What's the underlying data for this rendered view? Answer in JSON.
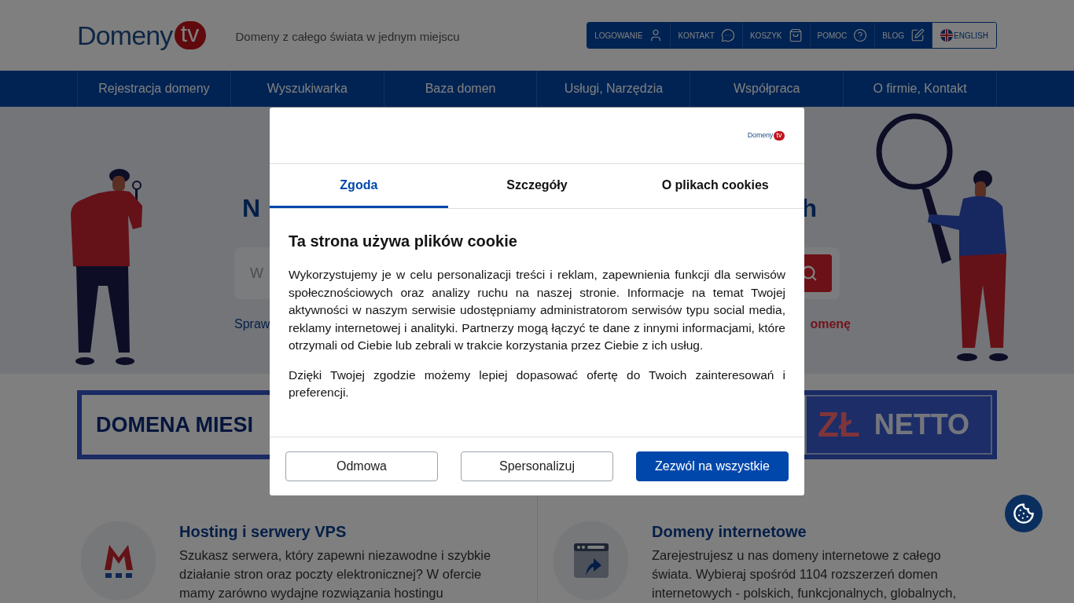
{
  "header": {
    "logo": {
      "name": "Domeny",
      "tld": "tv"
    },
    "tagline": "Domeny z całego świata w jednym miejscu",
    "top_links": [
      {
        "label": "LOGOWANIE",
        "kind": "user"
      },
      {
        "label": "KONTAKT",
        "kind": "chat"
      },
      {
        "label": "KOSZYK",
        "kind": "bag"
      },
      {
        "label": "POMOC",
        "kind": "help"
      },
      {
        "label": "BLOG",
        "kind": "edit"
      }
    ],
    "language": "ENGLISH"
  },
  "nav": [
    "Rejestracja domeny",
    "Wyszukiwarka",
    "Baza domen",
    "Usługi, Narzędzia",
    "Współpraca",
    "O firmie, Kontakt"
  ],
  "hero": {
    "heading_left": "N",
    "heading_right": "h",
    "search_placeholder": "W",
    "link_left": "Spraw",
    "link_right": "omenę"
  },
  "banner": {
    "left_text": "DOMENA MIESI",
    "currency": "ZŁ",
    "suffix": "NETTO"
  },
  "features": [
    {
      "kind": "hosting",
      "title": "Hosting i serwery VPS",
      "text": "Szukasz serwera, który zapewni niezawodne i szybkie działanie stron oraz poczty elektronicznej? W ofercie mamy zarówno wydajne rozwiązania hostingu"
    },
    {
      "kind": "domains",
      "title": "Domeny internetowe",
      "text": "Zarejestrujesz u nas domeny internetowe z całego świata. Wybieraj spośród 1104 rozszerzeń domen internetowych - polskich, funkcjonalnych, globalnych,"
    }
  ],
  "cookie_dialog": {
    "logo": {
      "name": "Domeny",
      "tld": "tv"
    },
    "tabs": [
      {
        "label": "Zgoda",
        "selected": true
      },
      {
        "label": "Szczegóły",
        "selected": false
      },
      {
        "label": "O plikach cookies",
        "selected": false
      }
    ],
    "title": "Ta strona używa plików cookie",
    "paragraphs": [
      "Wykorzystujemy je w celu personalizacji treści i reklam, zapewnienia funkcji dla serwisów społecznościowych oraz analizy ruchu na naszej stronie. Informacje na temat Twojej aktywności w naszym serwisie udostępniamy administratorom serwisów typu social media, reklamy internetowej i analityki. Partnerzy mogą łączyć te dane z innymi informacjami, które otrzymali od Ciebie lub zebrali w trakcie korzystania przez Ciebie z ich usług.",
      "Dzięki Twojej zgodzie możemy lepiej dopasować ofertę do Twoich zainteresowań i preferencji."
    ],
    "buttons": [
      {
        "label": "Odmowa",
        "kind": "outline"
      },
      {
        "label": "Spersonalizuj",
        "kind": "outline"
      },
      {
        "label": "Zezwól na wszystkie",
        "kind": "primary"
      }
    ]
  }
}
